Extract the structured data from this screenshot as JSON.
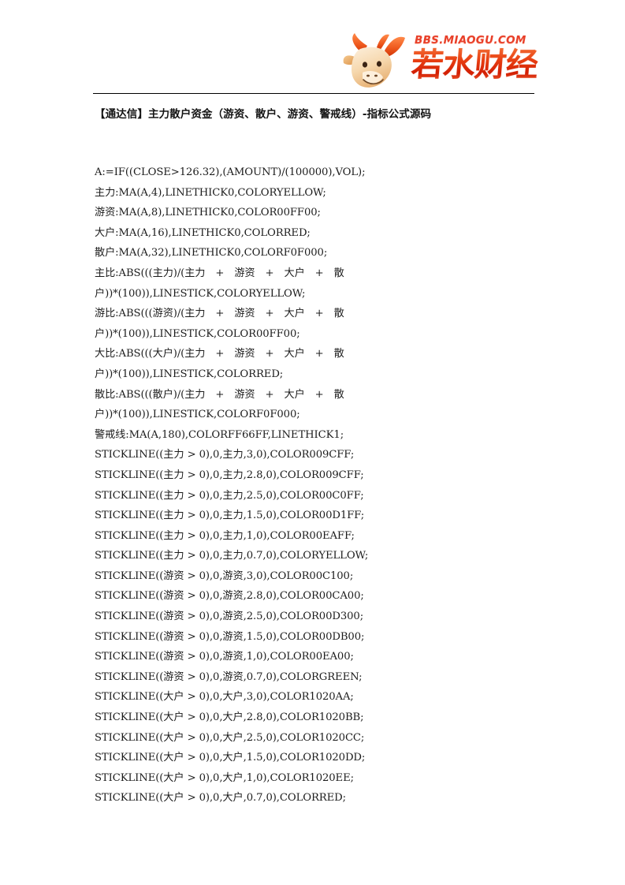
{
  "header": {
    "logo": {
      "mascot_icon": "bull-mascot-icon",
      "bbs_text": "BBS.MIAOGU.COM",
      "brand_text": "若水财经",
      "brand_color": "#e23a17",
      "bbs_color": "#e8402a"
    },
    "divider": "horizontal-rule"
  },
  "title": "【通达信】主力散户资金（游资、散户、游资、警戒线）-指标公式源码",
  "code": {
    "lines": [
      {
        "type": "single",
        "text": "A:=IF((CLOSE>126.32),(AMOUNT)/(100000),VOL);"
      },
      {
        "type": "single",
        "text": "主力:MA(A,4),LINETHICK0,COLORYELLOW;"
      },
      {
        "type": "single",
        "text": "游资:MA(A,8),LINETHICK0,COLOR00FF00;"
      },
      {
        "type": "single",
        "text": "大户:MA(A,16),LINETHICK0,COLORRED;"
      },
      {
        "type": "single",
        "text": "散户:MA(A,32),LINETHICK0,COLORF0F000;"
      },
      {
        "type": "wrap",
        "head": "主比:ABS(((主力)/(主力",
        "ops": [
          "游资",
          "大户",
          "散"
        ],
        "tail": "户))*(100)),LINESTICK,COLORYELLOW;"
      },
      {
        "type": "wrap",
        "head": "游比:ABS(((游资)/(主力",
        "ops": [
          "游资",
          "大户",
          "散"
        ],
        "tail": "户))*(100)),LINESTICK,COLOR00FF00;"
      },
      {
        "type": "wrap",
        "head": "大比:ABS(((大户)/(主力",
        "ops": [
          "游资",
          "大户",
          "散"
        ],
        "tail": "户))*(100)),LINESTICK,COLORRED;"
      },
      {
        "type": "wrap",
        "head": "散比:ABS(((散户)/(主力",
        "ops": [
          "游资",
          "大户",
          "散"
        ],
        "tail": "户))*(100)),LINESTICK,COLORF0F000;"
      },
      {
        "type": "single",
        "text": "警戒线:MA(A,180),COLORFF66FF,LINETHICK1;"
      },
      {
        "type": "single",
        "text": "STICKLINE((主力 > 0),0,主力,3,0),COLOR009CFF;"
      },
      {
        "type": "single",
        "text": "STICKLINE((主力 > 0),0,主力,2.8,0),COLOR009CFF;"
      },
      {
        "type": "single",
        "text": "STICKLINE((主力 > 0),0,主力,2.5,0),COLOR00C0FF;"
      },
      {
        "type": "single",
        "text": "STICKLINE((主力 > 0),0,主力,1.5,0),COLOR00D1FF;"
      },
      {
        "type": "single",
        "text": "STICKLINE((主力 > 0),0,主力,1,0),COLOR00EAFF;"
      },
      {
        "type": "single",
        "text": "STICKLINE((主力 > 0),0,主力,0.7,0),COLORYELLOW;"
      },
      {
        "type": "single",
        "text": "STICKLINE((游资 > 0),0,游资,3,0),COLOR00C100;"
      },
      {
        "type": "single",
        "text": "STICKLINE((游资 > 0),0,游资,2.8,0),COLOR00CA00;"
      },
      {
        "type": "single",
        "text": "STICKLINE((游资 > 0),0,游资,2.5,0),COLOR00D300;"
      },
      {
        "type": "single",
        "text": "STICKLINE((游资 > 0),0,游资,1.5,0),COLOR00DB00;"
      },
      {
        "type": "single",
        "text": "STICKLINE((游资 > 0),0,游资,1,0),COLOR00EA00;"
      },
      {
        "type": "single",
        "text": "STICKLINE((游资 > 0),0,游资,0.7,0),COLORGREEN;"
      },
      {
        "type": "single",
        "text": "STICKLINE((大户 > 0),0,大户,3,0),COLOR1020AA;"
      },
      {
        "type": "single",
        "text": "STICKLINE((大户 > 0),0,大户,2.8,0),COLOR1020BB;"
      },
      {
        "type": "single",
        "text": "STICKLINE((大户 > 0),0,大户,2.5,0),COLOR1020CC;"
      },
      {
        "type": "single",
        "text": "STICKLINE((大户 > 0),0,大户,1.5,0),COLOR1020DD;"
      },
      {
        "type": "single",
        "text": "STICKLINE((大户 > 0),0,大户,1,0),COLOR1020EE;"
      },
      {
        "type": "single",
        "text": "STICKLINE((大户 > 0),0,大户,0.7,0),COLORRED;"
      }
    ]
  }
}
